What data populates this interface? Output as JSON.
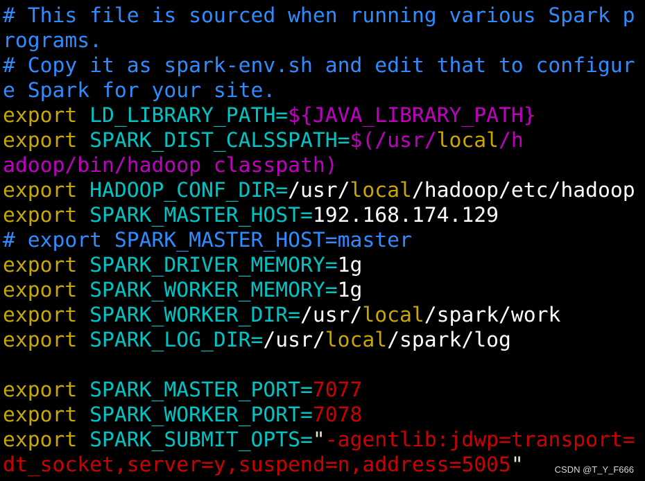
{
  "colors": {
    "comment": "#2f8cff",
    "keyword": "#c8a800",
    "ident": "#00c4c4",
    "special": "#c000c0",
    "string": "#cc0000",
    "text": "#ffffff",
    "quote": "#e8e8d0"
  },
  "lines": [
    [
      [
        "# This file is sourced when running various Spark p",
        "comment"
      ]
    ],
    [
      [
        "rograms.",
        "comment"
      ]
    ],
    [
      [
        "# Copy it as spark-env.sh and edit that to configur",
        "comment"
      ]
    ],
    [
      [
        "e Spark for your site.",
        "comment"
      ]
    ],
    [
      [
        "export",
        "keyword"
      ],
      [
        " LD_LIBRARY_PATH=",
        "ident"
      ],
      [
        "${JAVA_LIBRARY_PATH}",
        "special"
      ]
    ],
    [
      [
        "export",
        "keyword"
      ],
      [
        " SPARK_DIST_CALSSPATH=",
        "ident"
      ],
      [
        "$(/usr/",
        "special"
      ],
      [
        "local",
        "keyword"
      ],
      [
        "/h",
        "special"
      ]
    ],
    [
      [
        "adoop/bin/hadoop classpath)",
        "special"
      ]
    ],
    [
      [
        "export",
        "keyword"
      ],
      [
        " HADOOP_CONF_DIR=",
        "ident"
      ],
      [
        "/usr/",
        "text"
      ],
      [
        "local",
        "keyword"
      ],
      [
        "/hadoop/etc/hadoop",
        "text"
      ]
    ],
    [
      [
        "export",
        "keyword"
      ],
      [
        " SPARK_MASTER_HOST=",
        "ident"
      ],
      [
        "192.168.174.129",
        "text"
      ]
    ],
    [
      [
        "# export SPARK_MASTER_HOST=master",
        "comment"
      ]
    ],
    [
      [
        "export",
        "keyword"
      ],
      [
        " SPARK_DRIVER_MEMORY=",
        "ident"
      ],
      [
        "1g",
        "text"
      ]
    ],
    [
      [
        "export",
        "keyword"
      ],
      [
        " SPARK_WORKER_MEMORY=",
        "ident"
      ],
      [
        "1g",
        "text"
      ]
    ],
    [
      [
        "export",
        "keyword"
      ],
      [
        " SPARK_WORKER_DIR=",
        "ident"
      ],
      [
        "/usr/",
        "text"
      ],
      [
        "local",
        "keyword"
      ],
      [
        "/spark/work",
        "text"
      ]
    ],
    [
      [
        "export",
        "keyword"
      ],
      [
        " SPARK_LOG_DIR=",
        "ident"
      ],
      [
        "/usr/",
        "text"
      ],
      [
        "local",
        "keyword"
      ],
      [
        "/spark/log",
        "text"
      ]
    ],
    [],
    [
      [
        "export",
        "keyword"
      ],
      [
        " SPARK_MASTER_PORT=",
        "ident"
      ],
      [
        "7077",
        "string"
      ]
    ],
    [
      [
        "export",
        "keyword"
      ],
      [
        " SPARK_WORKER_PORT=",
        "ident"
      ],
      [
        "7078",
        "string"
      ]
    ],
    [
      [
        "export",
        "keyword"
      ],
      [
        " SPARK_SUBMIT_OPTS=",
        "ident"
      ],
      [
        "\"",
        "quote"
      ],
      [
        "-agentlib:jdwp=transport=",
        "string"
      ]
    ],
    [
      [
        "dt_socket,server=y,suspend=n,address=5005",
        "string"
      ],
      [
        "\"",
        "quote"
      ]
    ]
  ],
  "watermark": "CSDN @T_Y_F666"
}
